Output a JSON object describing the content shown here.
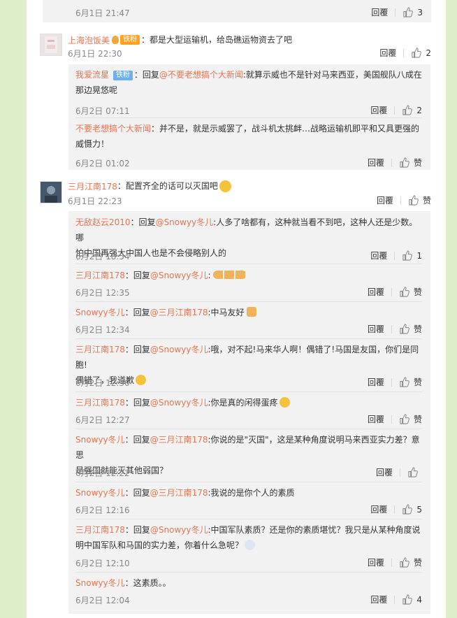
{
  "like_label": "赞",
  "top": {
    "time": "6月1日 21:47",
    "reply": "回覆",
    "likes": "3"
  },
  "c1": {
    "user": "上海泡饭美",
    "badge": "铁粉",
    "text": "：都是大型运输机，给岛礁运物资去了吧",
    "time": "6月1日 22:30",
    "reply": "回覆",
    "likes": "2",
    "replies": [
      {
        "user": "我爱流星",
        "badge": "铁粉",
        "prefix": "：回复",
        "at": "@不要老想搞个大新闻",
        "text1": ":就算示威也不是针对马来西亚，美国舰队八成在",
        "text2": "那边晃悠呢",
        "time": "6月2日 07:11",
        "reply": "回覆",
        "likes": "2"
      },
      {
        "user": "不要老想搞个大新闻",
        "text1": "：并不是，就是示威罢了，战斗机太挑衅…战略运输机即平和又具更强的",
        "text2": "威慑力！",
        "time": "6月2日 01:02",
        "reply": "回覆"
      }
    ]
  },
  "c2": {
    "user": "三月江南178",
    "text": "：配置齐全的话可以灭国吧",
    "time": "6月1日 22:23",
    "reply": "回覆",
    "replies": [
      {
        "user": "无敌赵云2010",
        "prefix": "：回复",
        "at": "@Snowyy冬儿",
        "text1": ":人多了啥都有，这种就当看不到吧，这种人还是少数。哪",
        "text2": "怕中国再强大中国人也是不会侵略别人的",
        "time": "6月2日 18:54",
        "reply": "回覆",
        "likes": "1"
      },
      {
        "user": "三月江南178",
        "prefix": "：回复",
        "at": "@Snowyy冬儿",
        "text1": ":",
        "time": "6月2日 12:35",
        "reply": "回覆"
      },
      {
        "user": "Snowyy冬儿",
        "prefix": "：回复",
        "at": "@三月江南178",
        "text1": ":中马友好",
        "time": "6月2日 12:34",
        "reply": "回覆"
      },
      {
        "user": "三月江南178",
        "prefix": "：回复",
        "at": "@Snowyy冬儿",
        "text1": ":哦，对不起!马来华人啊！偶错了!马国是友国，你们是同胞!",
        "text2": "偶错了，我道歉",
        "time": "6月2日 12:30",
        "reply": "回覆"
      },
      {
        "user": "三月江南178",
        "prefix": "：回复",
        "at": "@Snowyy冬儿",
        "text1": ":你是真的闲得蛋疼",
        "time": "6月2日 12:27",
        "reply": "回覆"
      },
      {
        "user": "Snowyy冬儿",
        "prefix": "：回复",
        "at": "@三月江南178",
        "text1": ":你说的是\"灭国\"，这是某种角度说明马来西亚实力差？意思",
        "text2": "是强国就能灭其他弱国？",
        "time": "6月2日 12:22",
        "reply": "回覆"
      },
      {
        "user": "Snowyy冬儿",
        "prefix": "：回复",
        "at": "@三月江南178",
        "text1": ":我说的是你个人的素质",
        "time": "6月2日 12:16",
        "reply": "回覆",
        "likes": "5"
      },
      {
        "user": "三月江南178",
        "prefix": "：回复",
        "at": "@Snowyy冬儿",
        "text1": ":中国军队素质？还是你的素质堪忧？我只是从某种角度说",
        "text2": "明中国军队和马国的实力差，你着什么急呢？",
        "time": "6月2日 12:10",
        "reply": "回覆"
      },
      {
        "user": "Snowyy冬儿",
        "text1": "：这素质。。",
        "time": "6月2日 12:04",
        "reply": "回覆",
        "likes": "4"
      }
    ]
  }
}
